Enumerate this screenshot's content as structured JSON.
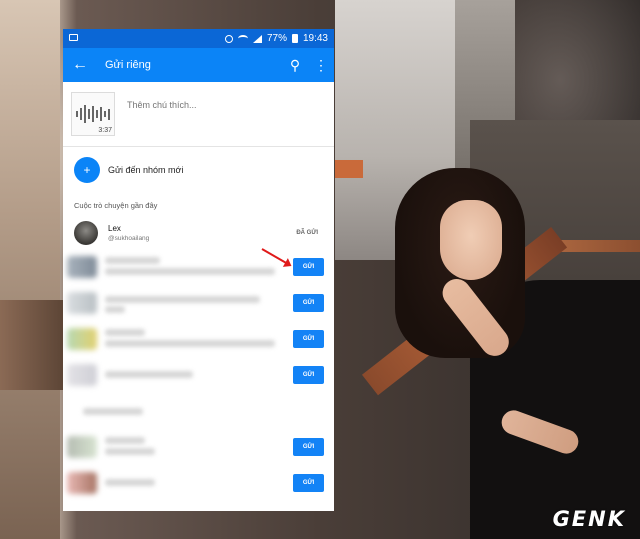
{
  "statusbar": {
    "battery": "77%",
    "time": "19:43"
  },
  "appbar": {
    "title": "Gửi riêng"
  },
  "share": {
    "duration": "3:37",
    "comment_placeholder": "Thêm chú thích..."
  },
  "new_group": {
    "label": "Gửi đến nhóm mới"
  },
  "recent": {
    "section_title": "Cuộc trò chuyện gần đây",
    "first_contact": {
      "name": "Lex",
      "handle": "@sukhoailang",
      "status": "ĐÃ GỬI"
    },
    "send_label": "GỬI"
  },
  "watermark": "GENK",
  "colors": {
    "statusbar": "#0b67d6",
    "appbar": "#0b84f7",
    "send_button": "#1383f6",
    "arrow": "#e01a1a"
  },
  "icons": [
    "image-icon",
    "alarm-icon",
    "wifi-icon",
    "signal-icon",
    "battery-icon",
    "back-icon",
    "search-icon",
    "more-icon",
    "waveform-icon",
    "group-add-icon"
  ]
}
